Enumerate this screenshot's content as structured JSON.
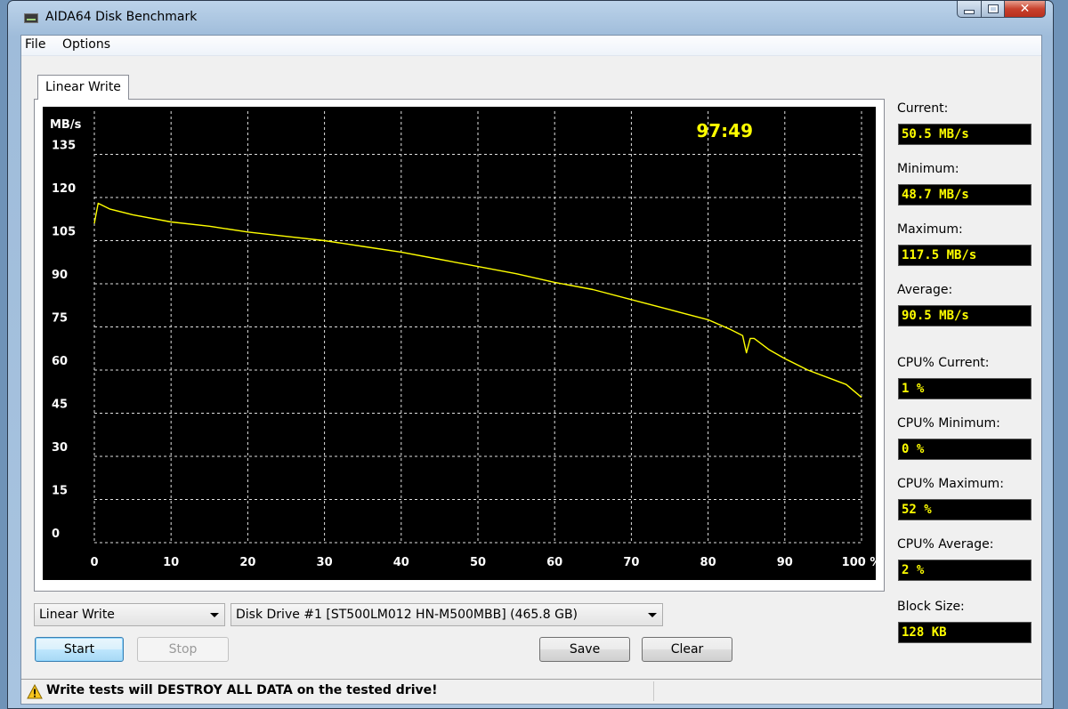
{
  "window": {
    "title": "AIDA64 Disk Benchmark"
  },
  "menu": [
    {
      "label": "File"
    },
    {
      "label": "Options"
    }
  ],
  "tab": {
    "label": "Linear Write"
  },
  "chart": {
    "timer": "97:49",
    "line_color": "#ffff00"
  },
  "stats": [
    {
      "label": "Current:",
      "value": "50.5 MB/s"
    },
    {
      "label": "Minimum:",
      "value": "48.7 MB/s"
    },
    {
      "label": "Maximum:",
      "value": "117.5 MB/s"
    },
    {
      "label": "Average:",
      "value": "90.5 MB/s"
    },
    {
      "label": "CPU% Current:",
      "value": "1 %"
    },
    {
      "label": "CPU% Minimum:",
      "value": "0 %"
    },
    {
      "label": "CPU% Maximum:",
      "value": "52 %"
    },
    {
      "label": "CPU% Average:",
      "value": "2 %"
    },
    {
      "label": "Block Size:",
      "value": "128 KB"
    }
  ],
  "controls": {
    "test_select": "Linear Write",
    "drive_select": "Disk Drive #1  [ST500LM012 HN-M500MBB]  (465.8 GB)",
    "start_label": "Start",
    "stop_label": "Stop",
    "save_label": "Save",
    "clear_label": "Clear"
  },
  "status": {
    "message": "Write tests will DESTROY ALL DATA on the tested drive!"
  },
  "chart_data": {
    "type": "line",
    "ylabel": "MB/s",
    "xlabel": "",
    "x_tick_labels": [
      "0",
      "10",
      "20",
      "30",
      "40",
      "50",
      "60",
      "70",
      "80",
      "90",
      "100 %"
    ],
    "y_tick_labels": [
      "0",
      "15",
      "30",
      "45",
      "60",
      "75",
      "90",
      "105",
      "120",
      "135"
    ],
    "xlim": [
      0,
      100
    ],
    "ylim": [
      0,
      150
    ],
    "grid": true,
    "series": [
      {
        "x": [
          0,
          0.5,
          2,
          5,
          10,
          15,
          20,
          25,
          30,
          35,
          40,
          45,
          50,
          55,
          60,
          65,
          70,
          75,
          80,
          83,
          84.5,
          85,
          85.5,
          86,
          88,
          90,
          93,
          96,
          98,
          100
        ],
        "y": [
          111,
          118,
          116,
          114,
          111.5,
          110,
          108,
          106.5,
          105,
          103,
          101,
          98.5,
          96,
          93.5,
          90.5,
          88,
          84.5,
          81,
          77.5,
          74,
          72,
          66,
          71,
          71,
          67,
          64,
          60,
          57,
          55,
          50.5
        ]
      }
    ]
  }
}
